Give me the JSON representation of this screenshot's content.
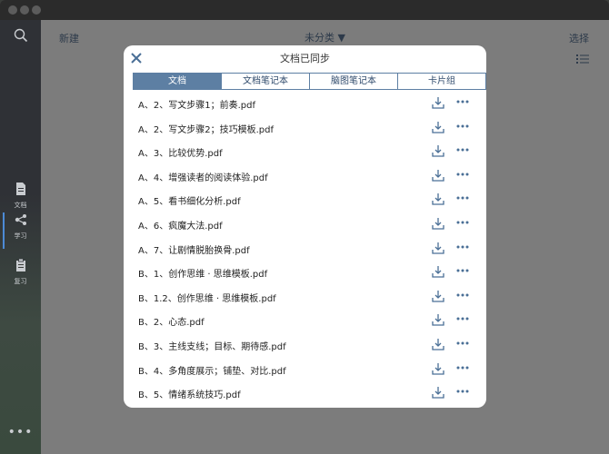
{
  "sidebar": {
    "items": [
      {
        "label": "文档",
        "icon": "document-icon"
      },
      {
        "label": "学习",
        "icon": "share-nodes-icon"
      },
      {
        "label": "复习",
        "icon": "clipboard-icon"
      }
    ],
    "active_index": 1,
    "more_label": "•••"
  },
  "toolbar": {
    "new_label": "新建",
    "category_label": "未分类 ▼",
    "select_label": "选择"
  },
  "modal": {
    "title": "文档已同步",
    "tabs": [
      "文档",
      "文档笔记本",
      "脑图笔记本",
      "卡片组"
    ],
    "active_tab": 0,
    "files": [
      "A、2、写文步骤1；前奏.pdf",
      "A、2、写文步骤2；技巧模板.pdf",
      "A、3、比较优势.pdf",
      "A、4、增强读者的阅读体验.pdf",
      "A、5、看书细化分析.pdf",
      "A、6、疯魔大法.pdf",
      "A、7、让剧情脱胎换骨.pdf",
      "B、1、创作思维 · 思维模板.pdf",
      "B、1.2、创作思维 · 思维模板.pdf",
      "B、2、心态.pdf",
      "B、3、主线支线；目标、期待感.pdf",
      "B、4、多角度展示；铺垫、对比.pdf",
      "B、5、情绪系统技巧.pdf"
    ]
  },
  "colors": {
    "accent": "#5d7fa3",
    "sidebar_active": "#4c8ad6",
    "icon_blue": "#4a6f96"
  }
}
